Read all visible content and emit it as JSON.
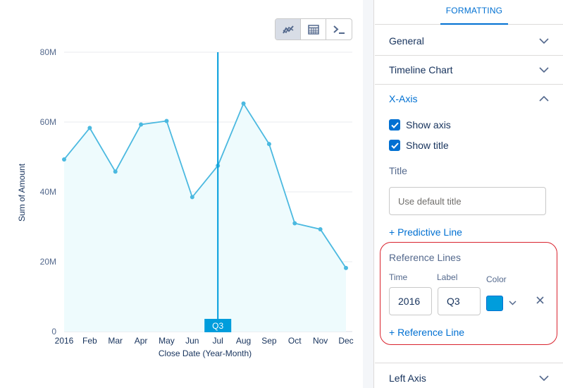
{
  "toolbar": {
    "view_buttons": [
      {
        "icon": "chart-icon",
        "active": true
      },
      {
        "icon": "table-icon",
        "active": false
      },
      {
        "icon": "query-console-icon",
        "active": false
      }
    ]
  },
  "chart_data": {
    "type": "area",
    "xlabel": "Close Date (Year-Month)",
    "ylabel": "Sum of Amount",
    "categories": [
      "2016",
      "Feb",
      "Mar",
      "Apr",
      "May",
      "Jun",
      "Jul",
      "Aug",
      "Sep",
      "Oct",
      "Nov",
      "Dec"
    ],
    "values": [
      49.3,
      58.3,
      45.8,
      59.3,
      60.3,
      38.5,
      47.5,
      65.3,
      53.7,
      31.0,
      29.3,
      18.2
    ],
    "y_unit": "M",
    "y_ticks": [
      0,
      20,
      40,
      60,
      80
    ],
    "y_tick_labels": [
      "0",
      "20M",
      "40M",
      "60M",
      "80M"
    ],
    "ylim": [
      0,
      80
    ],
    "grid": true,
    "line_color": "#4bb9e0",
    "fill_color": "#eefbfd",
    "reference_line": {
      "category": "Jul",
      "label": "Q3",
      "color": "#009ddc"
    }
  },
  "panel": {
    "tab_label": "FORMATTING",
    "sections": {
      "general": "General",
      "timeline_chart": "Timeline Chart",
      "x_axis": "X-Axis",
      "left_axis": "Left Axis"
    },
    "x_axis": {
      "show_axis_label": "Show axis",
      "show_axis_checked": true,
      "show_title_label": "Show title",
      "show_title_checked": true,
      "title_field_label": "Title",
      "title_placeholder": "Use default title",
      "predictive_line_link": "+ Predictive Line",
      "reference_lines": {
        "heading": "Reference Lines",
        "time_label": "Time",
        "label_label": "Label",
        "color_label": "Color",
        "time_value": "2016",
        "label_value": "Q3",
        "color_value": "#009ddc",
        "add_link": "+ Reference Line"
      }
    }
  }
}
